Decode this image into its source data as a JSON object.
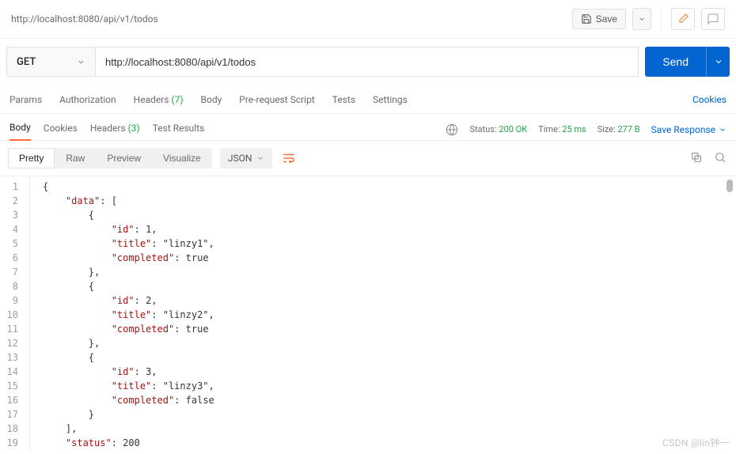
{
  "titlebar": {
    "title": "http://localhost:8080/api/v1/todos",
    "save_label": "Save"
  },
  "request": {
    "method": "GET",
    "url": "http://localhost:8080/api/v1/todos",
    "send_label": "Send"
  },
  "req_tabs": {
    "params": "Params",
    "authorization": "Authorization",
    "headers": "Headers",
    "headers_count": "(7)",
    "body_label": "Body",
    "prerequest": "Pre-request Script",
    "tests": "Tests",
    "settings": "Settings",
    "cookies_link": "Cookies"
  },
  "resp_tabs": {
    "body": "Body",
    "cookies": "Cookies",
    "headers": "Headers",
    "headers_count": "(3)",
    "test_results": "Test Results",
    "status_label": "Status:",
    "status_value": "200 OK",
    "time_label": "Time:",
    "time_value": "25 ms",
    "size_label": "Size:",
    "size_value": "277 B",
    "save_response": "Save Response"
  },
  "fmt": {
    "pretty": "Pretty",
    "raw": "Raw",
    "preview": "Preview",
    "visualize": "Visualize",
    "format": "JSON"
  },
  "code_lines": [
    "{",
    "    \"data\": [",
    "        {",
    "            \"id\": 1,",
    "            \"title\": \"linzy1\",",
    "            \"completed\": true",
    "        },",
    "        {",
    "            \"id\": 2,",
    "            \"title\": \"linzy2\",",
    "            \"completed\": true",
    "        },",
    "        {",
    "            \"id\": 3,",
    "            \"title\": \"linzy3\",",
    "            \"completed\": false",
    "        }",
    "    ],",
    "    \"status\": 200"
  ],
  "response_json": {
    "data": [
      {
        "id": 1,
        "title": "linzy1",
        "completed": true
      },
      {
        "id": 2,
        "title": "linzy2",
        "completed": true
      },
      {
        "id": 3,
        "title": "linzy3",
        "completed": false
      }
    ],
    "status": 200
  },
  "watermark": "CSDN @lin钟一"
}
